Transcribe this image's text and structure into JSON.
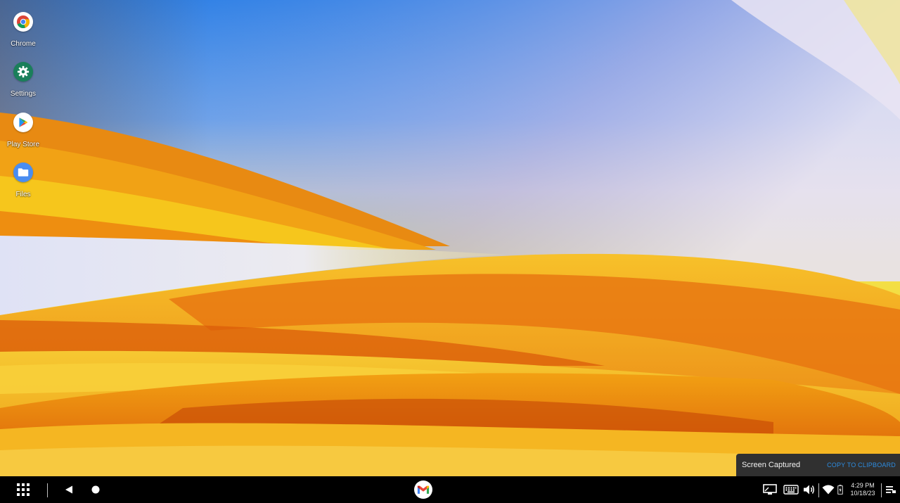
{
  "desktop": {
    "icons": [
      {
        "label": "Chrome",
        "icon": "chrome-icon"
      },
      {
        "label": "Settings",
        "icon": "settings-gear-icon"
      },
      {
        "label": "Play Store",
        "icon": "play-store-icon"
      },
      {
        "label": "Files",
        "icon": "folder-icon"
      }
    ]
  },
  "toast": {
    "message": "Screen Captured",
    "action": "COPY TO CLIPBOARD"
  },
  "taskbar": {
    "launcher_icon": "app-grid-icon",
    "back_icon": "back-triangle-icon",
    "home_icon": "home-circle-icon",
    "pinned_app_icon": "gmail-icon",
    "tray_icons": [
      "screen-cast-icon",
      "keyboard-icon",
      "volume-icon",
      "wifi-icon",
      "battery-icon",
      "notifications-icon"
    ],
    "time": "4:29 PM",
    "date": "10/18/23"
  },
  "colors": {
    "taskbar_bg": "#000000",
    "toast_bg": "#303030",
    "toast_action": "#2d8ce0",
    "settings_green": "#1a7f5a",
    "files_blue": "#4a8df0"
  }
}
